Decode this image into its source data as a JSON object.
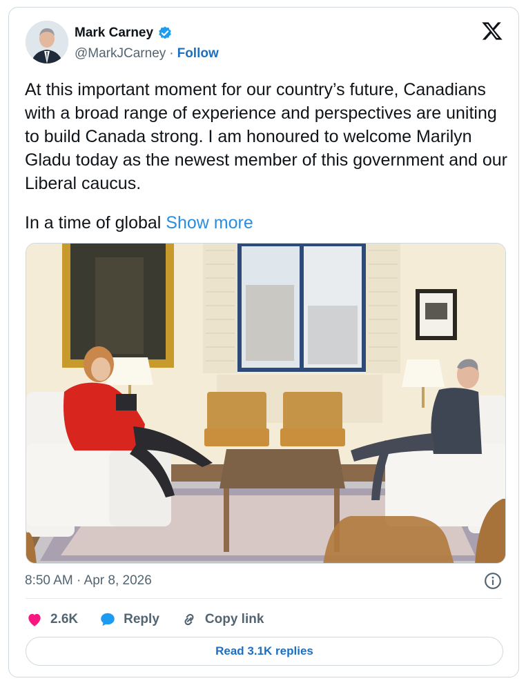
{
  "author": {
    "name": "Mark Carney",
    "handle": "@MarkJCarney",
    "separator": "·",
    "follow_label": "Follow"
  },
  "tweet": {
    "text": "At this important moment for our country’s future, Canadians with a broad range of experience and perspectives are uniting to build Canada strong. I am honoured to welcome Marilyn Gladu today as the newest member of this government and our Liberal caucus.",
    "text_truncated": "In a time of global",
    "show_more_label": "Show more",
    "timestamp": "8:50 AM · Apr 8, 2026"
  },
  "actions": {
    "likes": "2.6K",
    "reply_label": "Reply",
    "copy_link_label": "Copy link"
  },
  "read_replies_label": "Read 3.1K replies",
  "colors": {
    "accent": "#1d6fc1",
    "show_more": "#2a8de0",
    "heart": "#f91880",
    "verified": "#1d9bf0"
  }
}
